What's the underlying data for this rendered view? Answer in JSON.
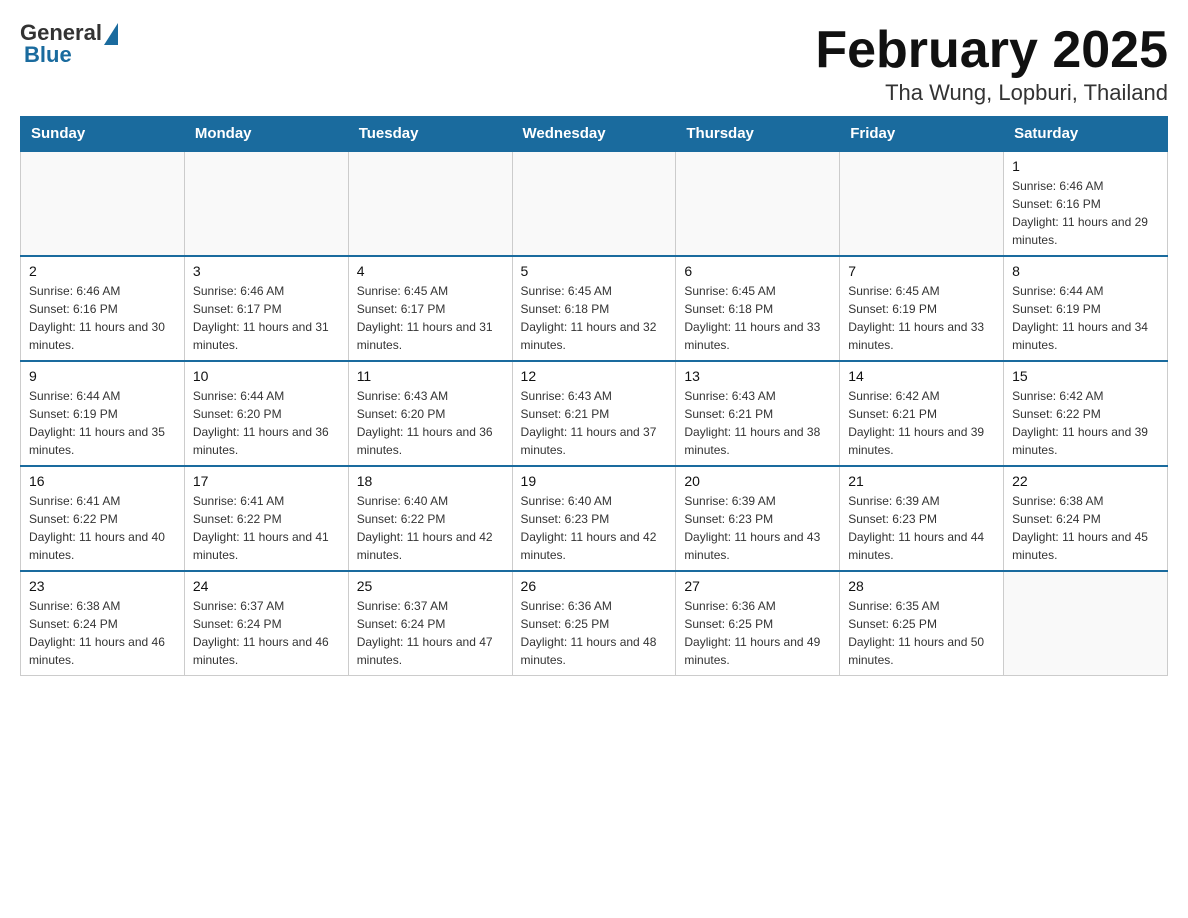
{
  "logo": {
    "general": "General",
    "blue_triangle": "▲",
    "blue": "Blue"
  },
  "title": "February 2025",
  "subtitle": "Tha Wung, Lopburi, Thailand",
  "days_of_week": [
    "Sunday",
    "Monday",
    "Tuesday",
    "Wednesday",
    "Thursday",
    "Friday",
    "Saturday"
  ],
  "weeks": [
    {
      "days": [
        {
          "num": "",
          "info": ""
        },
        {
          "num": "",
          "info": ""
        },
        {
          "num": "",
          "info": ""
        },
        {
          "num": "",
          "info": ""
        },
        {
          "num": "",
          "info": ""
        },
        {
          "num": "",
          "info": ""
        },
        {
          "num": "1",
          "info": "Sunrise: 6:46 AM\nSunset: 6:16 PM\nDaylight: 11 hours and 29 minutes."
        }
      ]
    },
    {
      "days": [
        {
          "num": "2",
          "info": "Sunrise: 6:46 AM\nSunset: 6:16 PM\nDaylight: 11 hours and 30 minutes."
        },
        {
          "num": "3",
          "info": "Sunrise: 6:46 AM\nSunset: 6:17 PM\nDaylight: 11 hours and 31 minutes."
        },
        {
          "num": "4",
          "info": "Sunrise: 6:45 AM\nSunset: 6:17 PM\nDaylight: 11 hours and 31 minutes."
        },
        {
          "num": "5",
          "info": "Sunrise: 6:45 AM\nSunset: 6:18 PM\nDaylight: 11 hours and 32 minutes."
        },
        {
          "num": "6",
          "info": "Sunrise: 6:45 AM\nSunset: 6:18 PM\nDaylight: 11 hours and 33 minutes."
        },
        {
          "num": "7",
          "info": "Sunrise: 6:45 AM\nSunset: 6:19 PM\nDaylight: 11 hours and 33 minutes."
        },
        {
          "num": "8",
          "info": "Sunrise: 6:44 AM\nSunset: 6:19 PM\nDaylight: 11 hours and 34 minutes."
        }
      ]
    },
    {
      "days": [
        {
          "num": "9",
          "info": "Sunrise: 6:44 AM\nSunset: 6:19 PM\nDaylight: 11 hours and 35 minutes."
        },
        {
          "num": "10",
          "info": "Sunrise: 6:44 AM\nSunset: 6:20 PM\nDaylight: 11 hours and 36 minutes."
        },
        {
          "num": "11",
          "info": "Sunrise: 6:43 AM\nSunset: 6:20 PM\nDaylight: 11 hours and 36 minutes."
        },
        {
          "num": "12",
          "info": "Sunrise: 6:43 AM\nSunset: 6:21 PM\nDaylight: 11 hours and 37 minutes."
        },
        {
          "num": "13",
          "info": "Sunrise: 6:43 AM\nSunset: 6:21 PM\nDaylight: 11 hours and 38 minutes."
        },
        {
          "num": "14",
          "info": "Sunrise: 6:42 AM\nSunset: 6:21 PM\nDaylight: 11 hours and 39 minutes."
        },
        {
          "num": "15",
          "info": "Sunrise: 6:42 AM\nSunset: 6:22 PM\nDaylight: 11 hours and 39 minutes."
        }
      ]
    },
    {
      "days": [
        {
          "num": "16",
          "info": "Sunrise: 6:41 AM\nSunset: 6:22 PM\nDaylight: 11 hours and 40 minutes."
        },
        {
          "num": "17",
          "info": "Sunrise: 6:41 AM\nSunset: 6:22 PM\nDaylight: 11 hours and 41 minutes."
        },
        {
          "num": "18",
          "info": "Sunrise: 6:40 AM\nSunset: 6:22 PM\nDaylight: 11 hours and 42 minutes."
        },
        {
          "num": "19",
          "info": "Sunrise: 6:40 AM\nSunset: 6:23 PM\nDaylight: 11 hours and 42 minutes."
        },
        {
          "num": "20",
          "info": "Sunrise: 6:39 AM\nSunset: 6:23 PM\nDaylight: 11 hours and 43 minutes."
        },
        {
          "num": "21",
          "info": "Sunrise: 6:39 AM\nSunset: 6:23 PM\nDaylight: 11 hours and 44 minutes."
        },
        {
          "num": "22",
          "info": "Sunrise: 6:38 AM\nSunset: 6:24 PM\nDaylight: 11 hours and 45 minutes."
        }
      ]
    },
    {
      "days": [
        {
          "num": "23",
          "info": "Sunrise: 6:38 AM\nSunset: 6:24 PM\nDaylight: 11 hours and 46 minutes."
        },
        {
          "num": "24",
          "info": "Sunrise: 6:37 AM\nSunset: 6:24 PM\nDaylight: 11 hours and 46 minutes."
        },
        {
          "num": "25",
          "info": "Sunrise: 6:37 AM\nSunset: 6:24 PM\nDaylight: 11 hours and 47 minutes."
        },
        {
          "num": "26",
          "info": "Sunrise: 6:36 AM\nSunset: 6:25 PM\nDaylight: 11 hours and 48 minutes."
        },
        {
          "num": "27",
          "info": "Sunrise: 6:36 AM\nSunset: 6:25 PM\nDaylight: 11 hours and 49 minutes."
        },
        {
          "num": "28",
          "info": "Sunrise: 6:35 AM\nSunset: 6:25 PM\nDaylight: 11 hours and 50 minutes."
        },
        {
          "num": "",
          "info": ""
        }
      ]
    }
  ]
}
